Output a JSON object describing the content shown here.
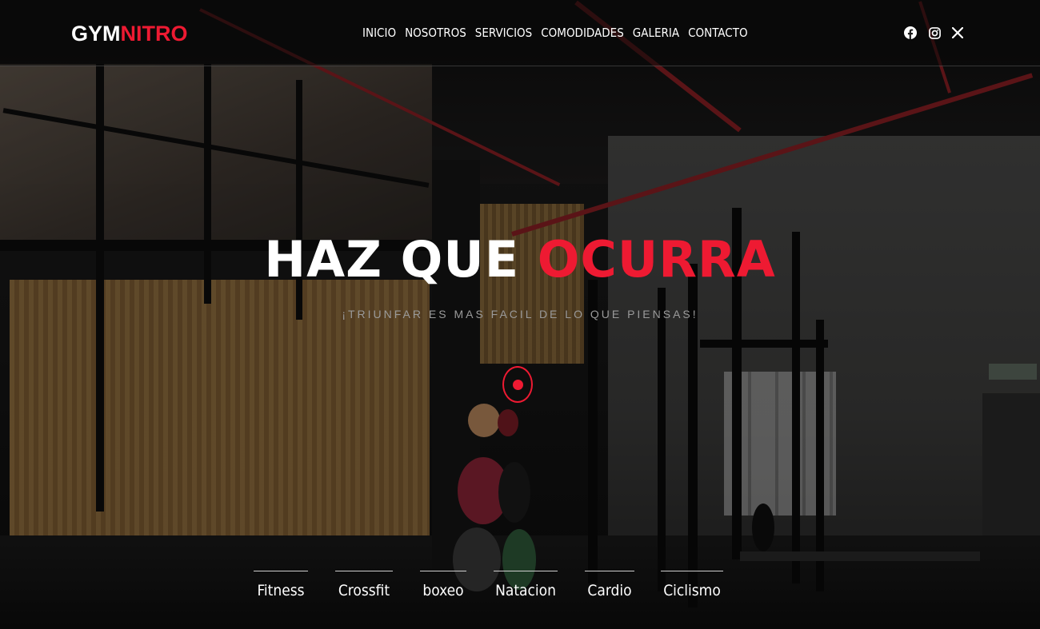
{
  "brand": {
    "part1": "GYM",
    "part2": "NITRO",
    "accent_color": "#ee1a32"
  },
  "nav": {
    "items": [
      {
        "label": "INICIO"
      },
      {
        "label": "NOSOTROS"
      },
      {
        "label": "SERVICIOS"
      },
      {
        "label": "COMODIDADES"
      },
      {
        "label": "GALERIA"
      },
      {
        "label": "CONTACTO"
      }
    ]
  },
  "social": [
    {
      "icon": "facebook-icon"
    },
    {
      "icon": "instagram-icon"
    },
    {
      "icon": "x-twitter-icon"
    }
  ],
  "hero": {
    "title_part1": "HAZ QUE",
    "title_part2": "OCURRA",
    "subtitle": "¡TRIUNFAR ES MAS FACIL DE LO QUE PIENSAS!",
    "scroll_icon": "scroll-down-icon"
  },
  "categories": [
    {
      "label": "Fitness"
    },
    {
      "label": "Crossfit"
    },
    {
      "label": "boxeo"
    },
    {
      "label": "Natacion"
    },
    {
      "label": "Cardio"
    },
    {
      "label": "Ciclismo"
    }
  ]
}
